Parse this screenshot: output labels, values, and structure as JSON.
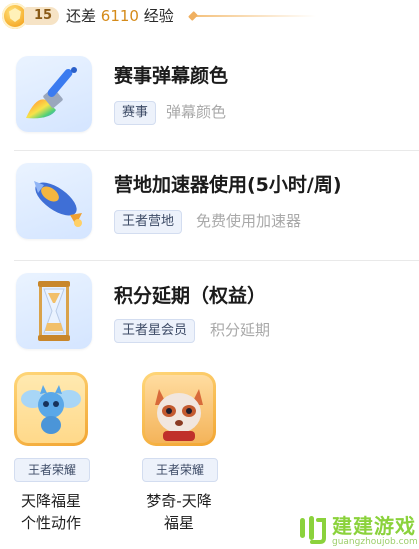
{
  "level": {
    "number": "15",
    "text_prefix": "还差",
    "exp_value": "6110",
    "text_suffix": "经验"
  },
  "rows": [
    {
      "icon": "paintbrush-icon",
      "title": "赛事弹幕颜色",
      "tag": "赛事",
      "desc": "弹幕颜色"
    },
    {
      "icon": "rocket-icon",
      "title": "营地加速器使用(5小时/周)",
      "tag": "王者营地",
      "desc": "免费使用加速器"
    },
    {
      "icon": "hourglass-icon",
      "title": "积分延期（权益）",
      "tag": "王者星会员",
      "desc": "积分延期"
    }
  ],
  "cards": [
    {
      "icon": "winged-cat-icon",
      "tag": "王者荣耀",
      "name_line1": "天降福星",
      "name_line2": "个性动作"
    },
    {
      "icon": "raccoon-hero-icon",
      "tag": "王者荣耀",
      "name_line1": "梦奇-天降",
      "name_line2": "福星"
    }
  ],
  "watermark": {
    "text": "建建游戏",
    "url": "guangzhoujob.com"
  },
  "colors": {
    "accent_orange": "#d58b1a",
    "tag_bg": "#edf2fb",
    "watermark_green": "#8bd23c"
  }
}
